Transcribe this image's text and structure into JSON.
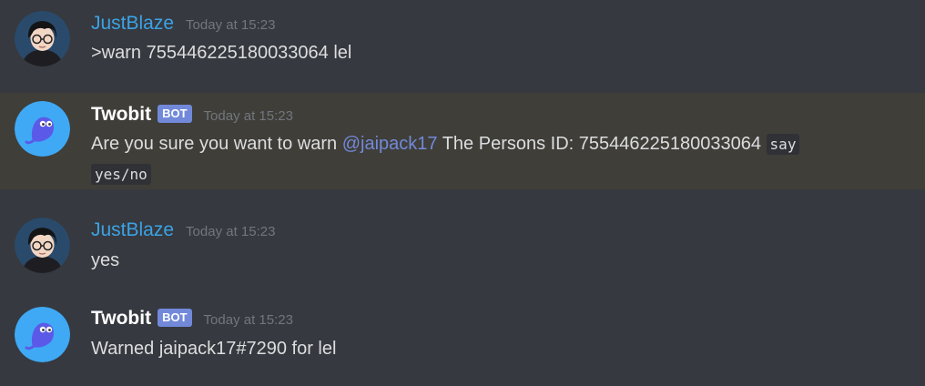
{
  "messages": [
    {
      "author": "JustBlaze",
      "timestamp": "Today at 15:23",
      "text": ">warn 755446225180033064 lel"
    },
    {
      "author": "Twobit",
      "badge": "BOT",
      "timestamp": "Today at 15:23",
      "text_before": "Are you sure you want to warn ",
      "mention": "@jaipack17",
      "text_after": " The Persons ID: 755446225180033064 ",
      "code_line1": "say",
      "code_line2": "yes/no"
    },
    {
      "author": "JustBlaze",
      "timestamp": "Today at 15:23",
      "text": "yes"
    },
    {
      "author": "Twobit",
      "badge": "BOT",
      "timestamp": "Today at 15:23",
      "text": "Warned jaipack17#7290 for lel"
    }
  ],
  "colors": {
    "background": "#36393f",
    "highlight": "#3f3e39",
    "user_name": "#3ba3e5",
    "bot_name": "#ffffff",
    "badge": "#7289da",
    "mention": "#7289da",
    "timestamp": "#72767d",
    "text": "#dcddde"
  }
}
